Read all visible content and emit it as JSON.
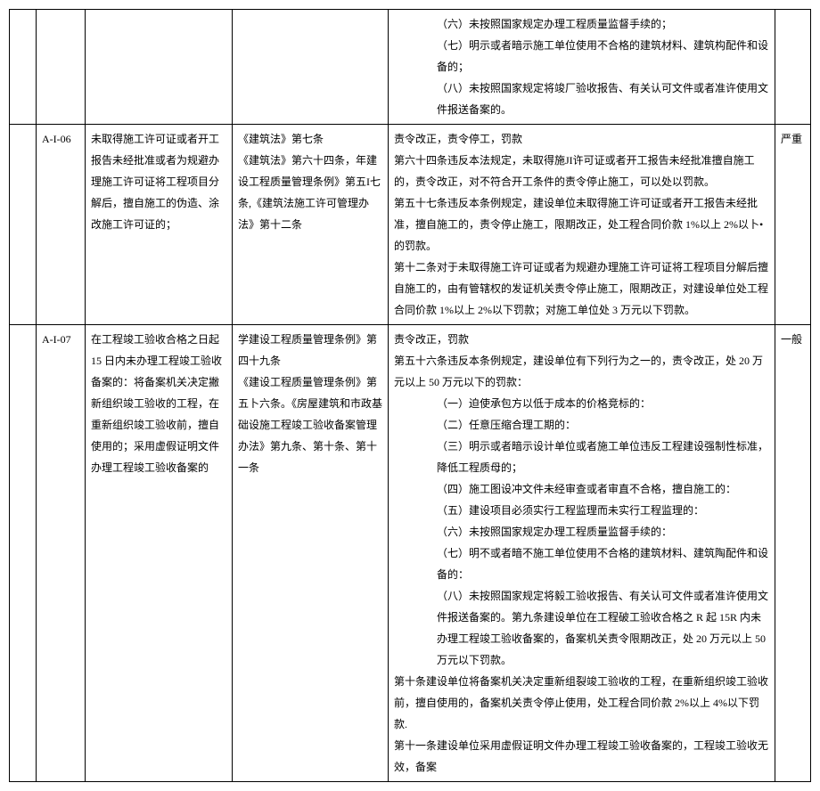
{
  "rows": [
    {
      "col1": "",
      "col2": "",
      "col3": "",
      "col4": "",
      "col5_lines": [
        {
          "indent": true,
          "text": "（六）未按照国家规定办理工程质量监督手续的；"
        },
        {
          "indent": true,
          "text": "（七）明示或者暗示施工单位使用不合格的建筑材料、建筑构配件和设备的；"
        },
        {
          "indent": true,
          "text": "（八）未按照国家规定将竣厂验收报告、有关认可文件或者准许使用文件报送备案的。"
        }
      ],
      "col6": ""
    },
    {
      "col1": "",
      "col2": "A-I-06",
      "col3": "未取得施工许可证或者开工报告未经批准或者为规避办理施工许可证将工程项目分解后，擅自施工的伪造、涂改施工许可证的；",
      "col4": "《建筑法》第七条\n《建筑法》第六十四条，年建设工程质量管理条例》第五I七条,《建筑法施工许可管理办法》第十二条",
      "col5_lines": [
        {
          "indent": false,
          "text": "责令改正，责令停工，罚款"
        },
        {
          "indent": false,
          "text": "第六十四条违反本法规定，未取得施JI许可证或者开工报告未经批准擅自施工的，责令改正，对不符合开工条件的责令停止施工，可以处以罚款。"
        },
        {
          "indent": false,
          "text": "第五十七条违反本条例规定，建设单位未取得施工许可证或者开工报告未经批准，擅自施工的，责令停止施工，限期改正，处工程合同价款 1%以上 2%以卜•的罚款。"
        },
        {
          "indent": false,
          "text": "第十二条对于未取得施工许可证或者为规避办理施工许可证将工程项目分解后擅自施工的，由有管辖权的发证机关责令停止施工，限期改正，对建设单位处工程合同价款 1%以上 2%以下罚款；对施工单位处 3 万元以下罚款。"
        }
      ],
      "col6": "严重"
    },
    {
      "col1": "",
      "col2": "A-I-07",
      "col3": "在工程竣工验收合格之日起 15 日内未办理工程竣工验收备案的：将备案机关决定撇新组织竣工验收的工程，在重新组织竣工验收前，擅自使用的；采用虚假证明文件办理工程竣工验收备案的",
      "col4": "学建设工程质量管理条例》第四十九条\n《建设工程质量管理条例》第五卜六条。《房屋建筑和市政基础设施工程竣工验收备案管理办法》第九条、第十条、第十一条",
      "col5_lines": [
        {
          "indent": false,
          "text": "责令改正，罚款"
        },
        {
          "indent": false,
          "text": "第五十六条违反本条例规定，建设单位有下列行为之一的，责令改正，处 20 万元以上 50 万元以下的罚款："
        },
        {
          "indent": true,
          "text": "（一）迫使承包方以低于成本的价格竞标的："
        },
        {
          "indent": true,
          "text": "（二）任意压缩合理工期的："
        },
        {
          "indent": true,
          "text": "（三）明示或者暗示设计单位或者施工单位违反工程建设强制性标准，降低工程质母的；"
        },
        {
          "indent": true,
          "text": "（四）施工图设冲文件未经审查或者审直不合格，擅自施工的："
        },
        {
          "indent": true,
          "text": "（五）建设项目必须实行工程监理而未实行工程监理的："
        },
        {
          "indent": true,
          "text": "（六）未按照国家规定办理工程质量监督手续的："
        },
        {
          "indent": true,
          "text": "（七）明不或者暗不施工单位使用不合格的建筑材料、建筑陶配件和设备的："
        },
        {
          "indent": true,
          "text": "（八）未按照国家规定将毅工验收报告、有关认可文件或者准许使用文件报送备案的。第九条建设单位在工程破工验收合格之 R 起 15R 内未办理工程竣工验收备案的，备案机关责令限期改正，处 20 万元以上 50 万元以下罚款。"
        },
        {
          "indent": false,
          "text": "第十条建设单位将备案机关决定重新组裂竣工验收的工程，在重新组织竣工验收前，擅自使用的，备案机关责令停止使用，处工程合同价款 2%以上 4%以下罚款."
        },
        {
          "indent": false,
          "text": "第十一条建设单位采用虚假证明文件办理工程竣工验收备案的，工程竣工验收无效，备案"
        }
      ],
      "col6": "一般"
    }
  ]
}
